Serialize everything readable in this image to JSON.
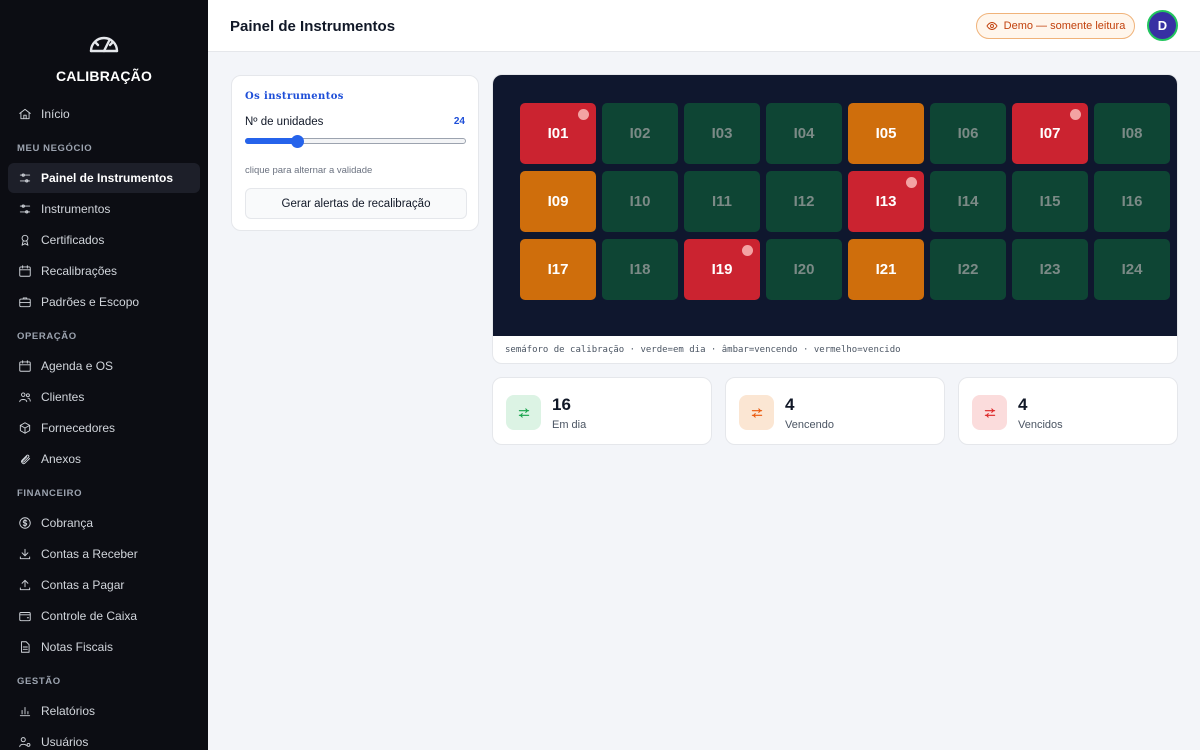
{
  "brand": {
    "name": "CALIBRAÇÃO",
    "logo_icon": "gauge-icon"
  },
  "sidebar": {
    "items": [
      {
        "label": "Início",
        "icon": "home-icon"
      },
      {
        "section": "MEU NEGÓCIO"
      },
      {
        "label": "Painel de Instrumentos",
        "icon": "sliders-icon",
        "active": true
      },
      {
        "label": "Instrumentos",
        "icon": "sliders-icon"
      },
      {
        "label": "Certificados",
        "icon": "award-icon"
      },
      {
        "label": "Recalibrações",
        "icon": "calendar-icon"
      },
      {
        "label": "Padrões e Escopo",
        "icon": "briefcase-icon"
      },
      {
        "section": "OPERAÇÃO"
      },
      {
        "label": "Agenda e OS",
        "icon": "calendar-icon"
      },
      {
        "label": "Clientes",
        "icon": "users-icon"
      },
      {
        "label": "Fornecedores",
        "icon": "box-icon"
      },
      {
        "label": "Anexos",
        "icon": "paperclip-icon"
      },
      {
        "section": "FINANCEIRO"
      },
      {
        "label": "Cobrança",
        "icon": "dollar-icon"
      },
      {
        "label": "Contas a Receber",
        "icon": "download-icon"
      },
      {
        "label": "Contas a Pagar",
        "icon": "upload-icon"
      },
      {
        "label": "Controle de Caixa",
        "icon": "wallet-icon"
      },
      {
        "label": "Notas Fiscais",
        "icon": "file-icon"
      },
      {
        "section": "GESTÃO"
      },
      {
        "label": "Relatórios",
        "icon": "bar-chart-icon"
      },
      {
        "label": "Usuários",
        "icon": "user-cog-icon"
      }
    ]
  },
  "header": {
    "title": "Painel de Instrumentos",
    "demo_badge": "Demo — somente leitura",
    "avatar_initial": "D"
  },
  "controls": {
    "title": "Os instrumentos",
    "slider_label": "Nº de unidades",
    "slider_value": "24",
    "slider_min": 1,
    "slider_max": 100,
    "hint": "clique para alternar a validade",
    "alert_button": "Gerar alertas de recalibração"
  },
  "board": {
    "legend": "semáforo de calibração · verde=em dia · âmbar=vencendo · vermelho=vencido",
    "tiles": [
      {
        "id": "I01",
        "status": "bad"
      },
      {
        "id": "I02",
        "status": "ok"
      },
      {
        "id": "I03",
        "status": "ok"
      },
      {
        "id": "I04",
        "status": "ok"
      },
      {
        "id": "I05",
        "status": "warn"
      },
      {
        "id": "I06",
        "status": "ok"
      },
      {
        "id": "I07",
        "status": "bad"
      },
      {
        "id": "I08",
        "status": "ok"
      },
      {
        "id": "I09",
        "status": "warn"
      },
      {
        "id": "I10",
        "status": "ok"
      },
      {
        "id": "I11",
        "status": "ok"
      },
      {
        "id": "I12",
        "status": "ok"
      },
      {
        "id": "I13",
        "status": "bad"
      },
      {
        "id": "I14",
        "status": "ok"
      },
      {
        "id": "I15",
        "status": "ok"
      },
      {
        "id": "I16",
        "status": "ok"
      },
      {
        "id": "I17",
        "status": "warn"
      },
      {
        "id": "I18",
        "status": "ok"
      },
      {
        "id": "I19",
        "status": "bad"
      },
      {
        "id": "I20",
        "status": "ok"
      },
      {
        "id": "I21",
        "status": "warn"
      },
      {
        "id": "I22",
        "status": "ok"
      },
      {
        "id": "I23",
        "status": "ok"
      },
      {
        "id": "I24",
        "status": "ok"
      }
    ]
  },
  "summary": [
    {
      "value": "16",
      "label": "Em dia",
      "color": "#16a34a",
      "bg": "#dcf3e4"
    },
    {
      "value": "4",
      "label": "Vencendo",
      "color": "#ea580c",
      "bg": "#fbe6d3"
    },
    {
      "value": "4",
      "label": "Vencidos",
      "color": "#dc2626",
      "bg": "#fbdcdc"
    }
  ]
}
